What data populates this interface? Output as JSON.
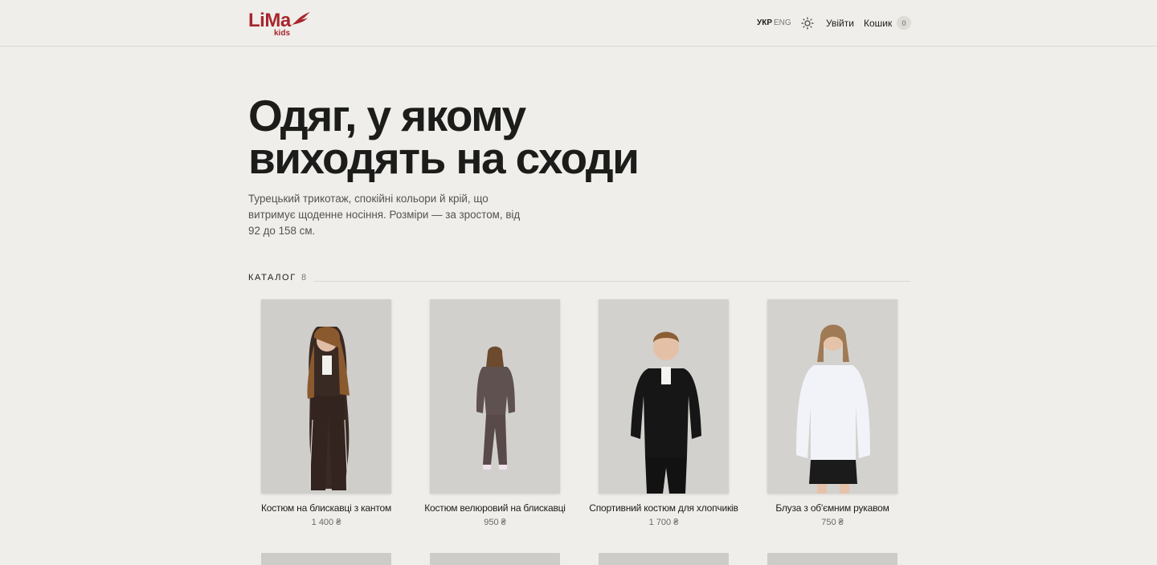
{
  "brand": {
    "name": "LiMa",
    "sub": "kids",
    "color": "#a8262d"
  },
  "nav": {
    "lang_active": "УКР",
    "lang_other": "ENG",
    "theme_icon": "sun-icon",
    "login_label": "Увійти",
    "cart_label": "Кошик",
    "cart_count": "0"
  },
  "hero": {
    "title_line1": "Одяг, у якому",
    "title_line2": "виходять на сходи",
    "text": "Турецький трикотаж, спокійні кольори й крій, що витримує щоденне носіння. Розміри — за зростом, від 92 до 158 см."
  },
  "catalog": {
    "label": "КАТАЛОГ",
    "count": "8",
    "products": [
      {
        "name": "Костюм на блискавці з кантом",
        "price": "1 400 ₴",
        "garment_color": "#3a2a24"
      },
      {
        "name": "Костюм велюровий на блискавці",
        "price": "950 ₴",
        "garment_color": "#5e5150"
      },
      {
        "name": "Спортивний костюм для хлопчиків",
        "price": "1 700 ₴",
        "garment_color": "#161616"
      },
      {
        "name": "Блуза з об'ємним рукавом",
        "price": "750 ₴",
        "garment_color": "#f2f3f8"
      }
    ]
  }
}
